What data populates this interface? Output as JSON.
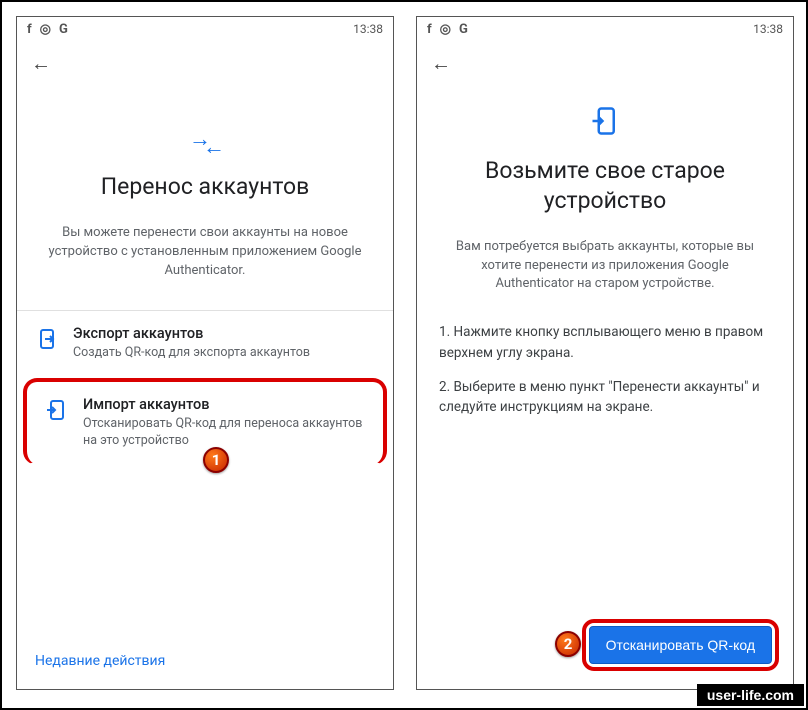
{
  "statusbar": {
    "time": "13:38",
    "icons": [
      "f",
      "◎",
      "G"
    ]
  },
  "screen1": {
    "title": "Перенос аккаунтов",
    "desc": "Вы можете перенести свои аккаунты на новое устройство с установленным приложением Google Authenticator.",
    "export": {
      "title": "Экспорт аккаунтов",
      "sub": "Создать QR-код для экспорта аккаунтов"
    },
    "import": {
      "title": "Импорт аккаунтов",
      "sub": "Отсканировать QR-код для переноса аккаунтов на это устройство"
    },
    "recent": "Недавние действия"
  },
  "screen2": {
    "title": "Возьмите свое старое устройство",
    "desc": "Вам потребуется выбрать аккаунты, которые вы хотите перенести из приложения Google Authenticator на старом устройстве.",
    "step1": "1. Нажмите кнопку всплывающего меню в правом верхнем углу экрана.",
    "step2": "2. Выберите в меню пункт \"Перенести аккаунты\" и следуйте инструкциям на экране.",
    "scan": "Отсканировать QR-код"
  },
  "badges": {
    "one": "1",
    "two": "2"
  },
  "watermark": "user-life.com"
}
